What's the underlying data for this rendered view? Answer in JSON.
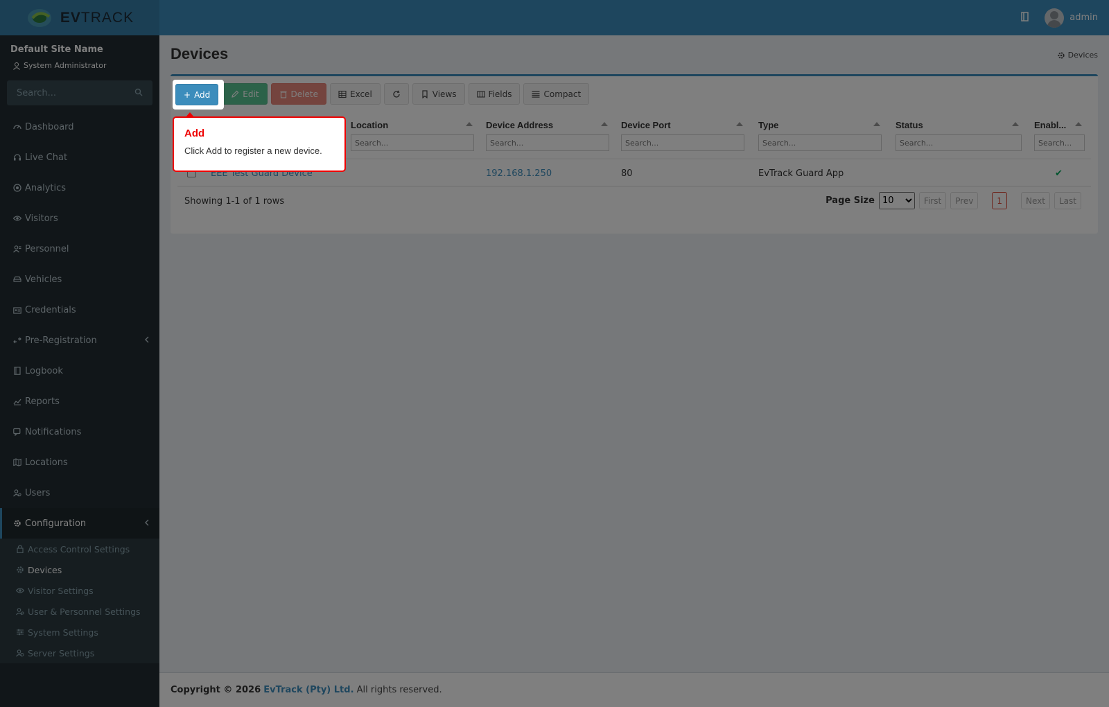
{
  "app": {
    "brand_prefix": "EV",
    "brand_suffix": "TRACK",
    "user": "admin"
  },
  "sidebar": {
    "site_name": "Default Site Name",
    "role": "System Administrator",
    "search_placeholder": "Search...",
    "items": [
      {
        "label": "Dashboard",
        "icon": "dashboard-icon"
      },
      {
        "label": "Live Chat",
        "icon": "headset-icon"
      },
      {
        "label": "Analytics",
        "icon": "analytics-icon"
      },
      {
        "label": "Visitors",
        "icon": "eye-icon"
      },
      {
        "label": "Personnel",
        "icon": "personnel-icon"
      },
      {
        "label": "Vehicles",
        "icon": "car-icon"
      },
      {
        "label": "Credentials",
        "icon": "credentials-icon"
      },
      {
        "label": "Pre-Registration",
        "icon": "pre-registration-icon"
      },
      {
        "label": "Logbook",
        "icon": "book-icon"
      },
      {
        "label": "Reports",
        "icon": "reports-icon"
      },
      {
        "label": "Notifications",
        "icon": "notifications-icon"
      },
      {
        "label": "Locations",
        "icon": "map-icon"
      },
      {
        "label": "Users",
        "icon": "users-icon"
      },
      {
        "label": "Configuration",
        "icon": "gear-icon"
      }
    ],
    "subitems": [
      {
        "label": "Access Control Settings",
        "icon": "lock-icon"
      },
      {
        "label": "Devices",
        "icon": "gear-icon"
      },
      {
        "label": "Visitor Settings",
        "icon": "eye-icon"
      },
      {
        "label": "User & Personnel Settings",
        "icon": "users-icon"
      },
      {
        "label": "System Settings",
        "icon": "sliders-icon"
      },
      {
        "label": "Server Settings",
        "icon": "server-icon"
      }
    ]
  },
  "page": {
    "title": "Devices",
    "breadcrumb": "Devices"
  },
  "toolbar": {
    "add": "Add",
    "edit": "Edit",
    "delete": "Delete",
    "excel": "Excel",
    "views": "Views",
    "fields": "Fields",
    "compact": "Compact"
  },
  "grid": {
    "columns": [
      "Location",
      "Device Address",
      "Device Port",
      "Type",
      "Status",
      "Enabl..."
    ],
    "filter_placeholder": "Search...",
    "row": {
      "name": "EEE Test Guard Device",
      "location": "",
      "address": "192.168.1.250",
      "port": "80",
      "type": "EvTrack Guard App",
      "status": "",
      "enabled": "✔"
    },
    "showing": "Showing 1-1 of 1 rows",
    "page_size_label": "Page Size",
    "page_size": "10",
    "pager": {
      "first": "First",
      "prev": "Prev",
      "current": "1",
      "next": "Next",
      "last": "Last"
    }
  },
  "footer": {
    "prefix": "Copyright © 2026",
    "company": "EvTrack (Pty) Ltd.",
    "suffix": "All rights reserved."
  },
  "tour": {
    "title": "Add",
    "body": "Click Add to register a new device."
  },
  "colors": {
    "header": "#3c8dbc",
    "sidebar": "#222d32",
    "popover_border": "#e00000"
  }
}
